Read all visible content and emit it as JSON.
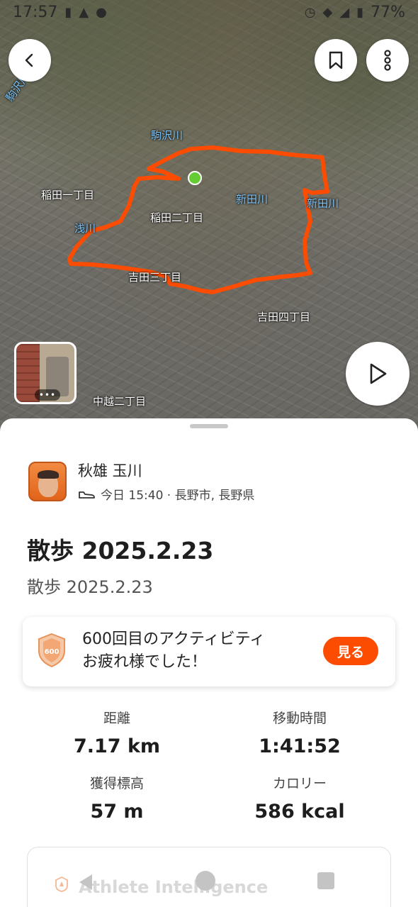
{
  "status_bar": {
    "time": "17:57",
    "battery": "77%"
  },
  "map": {
    "labels": [
      {
        "text": "駒沢川",
        "kind": "river"
      },
      {
        "text": "駒沢川",
        "kind": "river"
      },
      {
        "text": "新田川",
        "kind": "river"
      },
      {
        "text": "新田川",
        "kind": "river"
      },
      {
        "text": "浅川",
        "kind": "river"
      },
      {
        "text": "稲田一丁目",
        "kind": "district"
      },
      {
        "text": "稲田二丁目",
        "kind": "district"
      },
      {
        "text": "吉田三丁目",
        "kind": "district"
      },
      {
        "text": "吉田四丁目",
        "kind": "district"
      },
      {
        "text": "中越二丁目",
        "kind": "district"
      }
    ],
    "route_color": "#fc4c02",
    "start_marker_color": "#66cc33"
  },
  "toolbar": {
    "back_icon": "chevron-left-icon",
    "bookmark_icon": "bookmark-icon",
    "more_icon": "more-vertical-icon",
    "play_icon": "play-icon"
  },
  "photo": {
    "more_indicator": "•••"
  },
  "athlete": {
    "name": "秋雄 玉川",
    "meta": "今日 15:40 · 長野市, 長野県",
    "sport_icon": "shoe-icon"
  },
  "activity": {
    "title": "散歩 2025.2.23",
    "description": "散歩 2025.2.23"
  },
  "achievement": {
    "badge_number": "600",
    "text": "600回目のアクティビティ\nお疲れ様でした！",
    "button_label": "見る",
    "accent": "#fc4c02"
  },
  "stats": {
    "distance": {
      "label": "距離",
      "value": "7.17 km"
    },
    "moving_time": {
      "label": "移動時間",
      "value": "1:41:52"
    },
    "elevation": {
      "label": "獲得標高",
      "value": "57 m"
    },
    "calories": {
      "label": "カロリー",
      "value": "586 kcal"
    }
  },
  "athlete_intelligence": {
    "label": "Athlete Intelligence"
  }
}
